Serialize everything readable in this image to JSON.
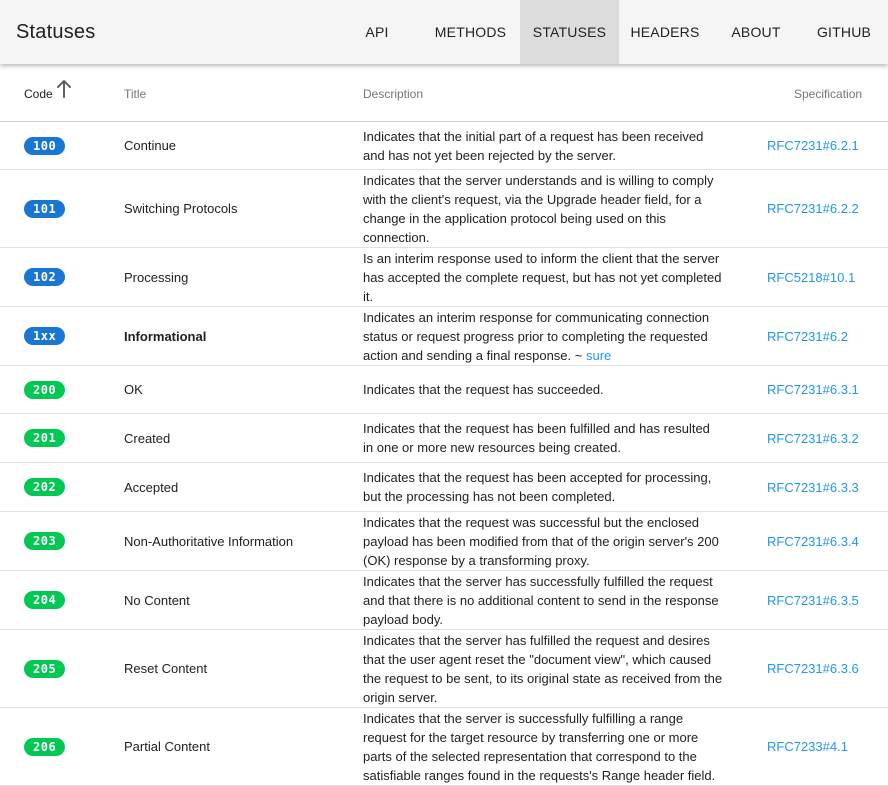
{
  "app": {
    "title": "Statuses"
  },
  "nav": [
    {
      "label": "API",
      "active": false
    },
    {
      "label": "METHODS",
      "active": false
    },
    {
      "label": "STATUSES",
      "active": true
    },
    {
      "label": "HEADERS",
      "active": false
    },
    {
      "label": "ABOUT",
      "active": false
    },
    {
      "label": "GITHUB",
      "active": false
    }
  ],
  "table": {
    "headers": {
      "code": "Code",
      "title": "Title",
      "description": "Description",
      "specification": "Specification"
    },
    "sort_icon": "arrow-up-icon",
    "rows": [
      {
        "code": "100",
        "group": "info",
        "title": "Continue",
        "description": "Indicates that the initial part of a request has been received and has not yet been rejected by the server.",
        "spec": "RFC7231#6.2.1"
      },
      {
        "code": "101",
        "group": "info",
        "title": "Switching Protocols",
        "description": "Indicates that the server understands and is willing to comply with the client's request, via the Upgrade header field, for a change in the application protocol being used on this connection.",
        "spec": "RFC7231#6.2.2"
      },
      {
        "code": "102",
        "group": "info",
        "title": "Processing",
        "description": "Is an interim response used to inform the client that the server has accepted the complete request, but has not yet completed it.",
        "spec": "RFC5218#10.1"
      },
      {
        "code": "1xx",
        "group": "info",
        "title": "Informational",
        "title_bold": true,
        "description": "Indicates an interim response for communicating connection status or request progress prior to completing the requested action and sending a final response. ~",
        "description_link": "sure",
        "spec": "RFC7231#6.2"
      },
      {
        "code": "200",
        "group": "success",
        "title": "OK",
        "description": "Indicates that the request has succeeded.",
        "spec": "RFC7231#6.3.1"
      },
      {
        "code": "201",
        "group": "success",
        "title": "Created",
        "description": "Indicates that the request has been fulfilled and has resulted in one or more new resources being created.",
        "spec": "RFC7231#6.3.2"
      },
      {
        "code": "202",
        "group": "success",
        "title": "Accepted",
        "description": "Indicates that the request has been accepted for processing, but the processing has not been completed.",
        "spec": "RFC7231#6.3.3"
      },
      {
        "code": "203",
        "group": "success",
        "title": "Non-Authoritative Information",
        "description": "Indicates that the request was successful but the enclosed payload has been modified from that of the origin server's 200 (OK) response by a transforming proxy.",
        "spec": "RFC7231#6.3.4"
      },
      {
        "code": "204",
        "group": "success",
        "title": "No Content",
        "description": "Indicates that the server has successfully fulfilled the request and that there is no additional content to send in the response payload body.",
        "spec": "RFC7231#6.3.5"
      },
      {
        "code": "205",
        "group": "success",
        "title": "Reset Content",
        "description": "Indicates that the server has fulfilled the request and desires that the user agent reset the \"document view\", which caused the request to be sent, to its original state as received from the origin server.",
        "spec": "RFC7231#6.3.6"
      },
      {
        "code": "206",
        "group": "success",
        "title": "Partial Content",
        "description": "Indicates that the server is successfully fulfilling a range request for the target resource by transferring one or more parts of the selected representation that correspond to the satisfiable ranges found in the requests's Range header field.",
        "spec": "RFC7233#4.1"
      }
    ]
  },
  "colors": {
    "info": "#1976d2",
    "success": "#00c853",
    "link": "#2196f3",
    "appbar": "#f5f5f5",
    "active_tab": "#dcdcdc"
  }
}
